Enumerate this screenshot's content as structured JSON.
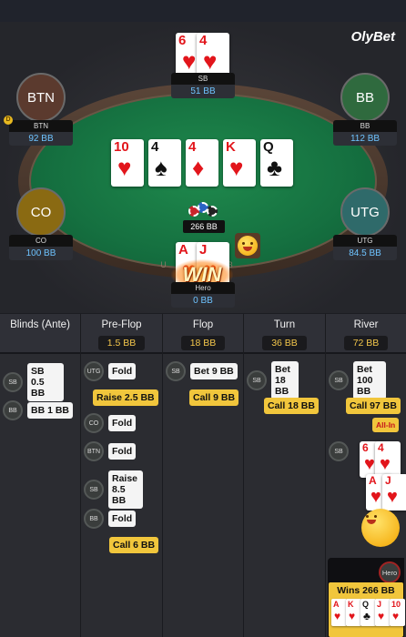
{
  "brand": "OlyBet",
  "rail_text": "U S B",
  "seats": {
    "sb": {
      "name": "SB",
      "stack": "51 BB",
      "avatar": ""
    },
    "btn": {
      "name": "BTN",
      "stack": "92 BB",
      "avatar": "BTN"
    },
    "bb": {
      "name": "BB",
      "stack": "112 BB",
      "avatar": "BB"
    },
    "co": {
      "name": "CO",
      "stack": "100 BB",
      "avatar": "CO"
    },
    "utg": {
      "name": "UTG",
      "stack": "84.5 BB",
      "avatar": "UTG"
    },
    "hero": {
      "name": "Hero",
      "stack": "0 BB"
    }
  },
  "dealer_label": "D",
  "sb_cards": [
    {
      "rank": "6",
      "suit": "♥",
      "color": "red"
    },
    {
      "rank": "4",
      "suit": "♥",
      "color": "red"
    }
  ],
  "board": [
    {
      "rank": "10",
      "suit": "♥",
      "color": "red"
    },
    {
      "rank": "4",
      "suit": "♠",
      "color": "black"
    },
    {
      "rank": "4",
      "suit": "♦",
      "color": "red"
    },
    {
      "rank": "K",
      "suit": "♥",
      "color": "red"
    },
    {
      "rank": "Q",
      "suit": "♣",
      "color": "black"
    }
  ],
  "hero_cards": [
    {
      "rank": "A",
      "suit": "♥",
      "color": "red"
    },
    {
      "rank": "J",
      "suit": "♥",
      "color": "red"
    }
  ],
  "pot": "266 BB",
  "win_label": "WIN",
  "columns": [
    {
      "title": "Blinds (Ante)",
      "pot": ""
    },
    {
      "title": "Pre-Flop",
      "pot": "1.5 BB"
    },
    {
      "title": "Flop",
      "pot": "18 BB"
    },
    {
      "title": "Turn",
      "pot": "36 BB"
    },
    {
      "title": "River",
      "pot": "72 BB"
    }
  ],
  "actions": {
    "blinds": [
      {
        "pos": "SB",
        "text": "SB 0.5 BB"
      },
      {
        "pos": "BB",
        "text": "BB 1 BB"
      }
    ],
    "preflop": [
      {
        "pos": "UTG",
        "text": "Fold"
      },
      {
        "hero": true,
        "text": "Raise 2.5 BB"
      },
      {
        "pos": "CO",
        "text": "Fold"
      },
      {
        "pos": "BTN",
        "text": "Fold"
      },
      {
        "pos": "SB",
        "text": "Raise 8.5 BB"
      },
      {
        "pos": "BB",
        "text": "Fold"
      },
      {
        "hero": true,
        "text": "Call 6 BB"
      }
    ],
    "flop": [
      {
        "pos": "SB",
        "text": "Bet 9 BB"
      },
      {
        "hero": true,
        "text": "Call 9 BB"
      }
    ],
    "turn": [
      {
        "pos": "SB",
        "text": "Bet 18 BB"
      },
      {
        "hero": true,
        "text": "Call 18 BB"
      }
    ],
    "river": [
      {
        "pos": "SB",
        "text": "Bet 100 BB"
      },
      {
        "hero": true,
        "text": "Call 97 BB"
      },
      {
        "tag": "All-In"
      }
    ]
  },
  "showdown": {
    "sb_cards": [
      {
        "rank": "6",
        "suit": "♥",
        "color": "red"
      },
      {
        "rank": "4",
        "suit": "♥",
        "color": "red"
      }
    ],
    "hero_cards": [
      {
        "rank": "A",
        "suit": "♥",
        "color": "red"
      },
      {
        "rank": "J",
        "suit": "♥",
        "color": "red"
      }
    ],
    "winner_pos": "Hero",
    "wins_text": "Wins 266 BB",
    "best_hand": [
      {
        "rank": "A",
        "suit": "♥",
        "color": "red"
      },
      {
        "rank": "K",
        "suit": "♥",
        "color": "red"
      },
      {
        "rank": "Q",
        "suit": "♣",
        "color": "black"
      },
      {
        "rank": "J",
        "suit": "♥",
        "color": "red"
      },
      {
        "rank": "10",
        "suit": "♥",
        "color": "red"
      }
    ]
  }
}
